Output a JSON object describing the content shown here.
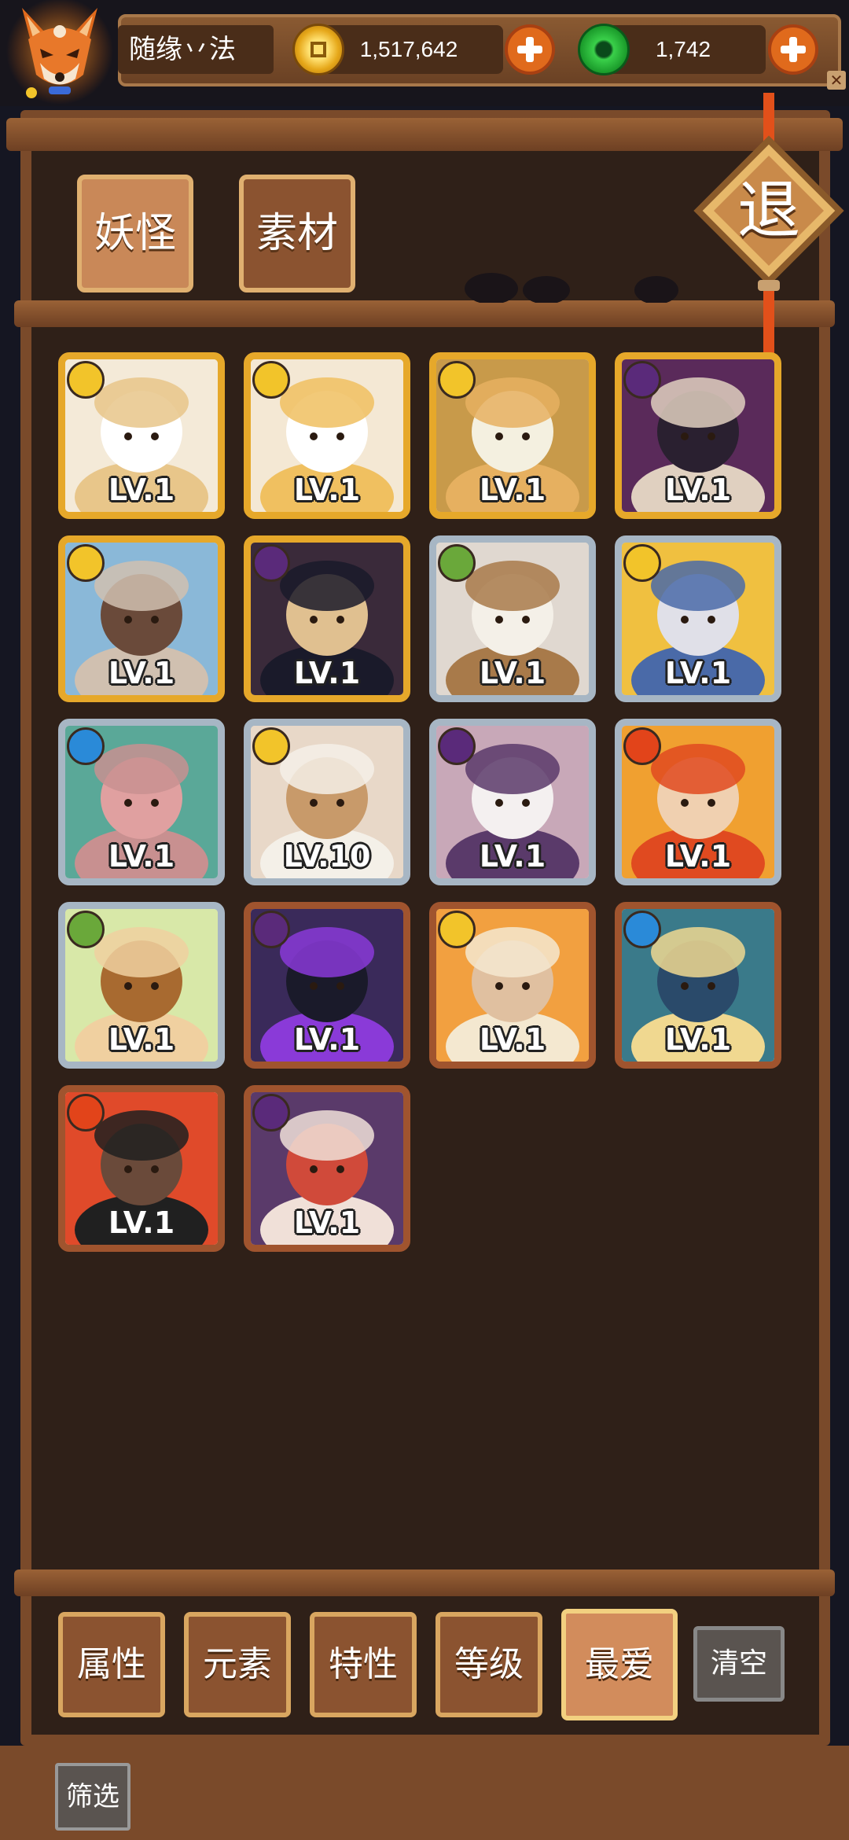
{
  "player": {
    "name": "随缘丷法"
  },
  "currency": {
    "coins": "1,517,642",
    "gems": "1,742"
  },
  "tabs": [
    {
      "label": "妖怪"
    },
    {
      "label": "素材"
    }
  ],
  "exit_label": "退",
  "cards": [
    {
      "level": "LV.1",
      "frame": "gold",
      "element": "light"
    },
    {
      "level": "LV.1",
      "frame": "gold",
      "element": "light"
    },
    {
      "level": "LV.1",
      "frame": "gold",
      "element": "light"
    },
    {
      "level": "LV.1",
      "frame": "gold",
      "element": "dark"
    },
    {
      "level": "LV.1",
      "frame": "gold",
      "element": "light"
    },
    {
      "level": "LV.1",
      "frame": "gold",
      "element": "dark"
    },
    {
      "level": "LV.1",
      "frame": "silver",
      "element": "wood"
    },
    {
      "level": "LV.1",
      "frame": "silver",
      "element": "light"
    },
    {
      "level": "LV.1",
      "frame": "silver",
      "element": "water"
    },
    {
      "level": "LV.10",
      "frame": "silver",
      "element": "light"
    },
    {
      "level": "LV.1",
      "frame": "silver",
      "element": "dark"
    },
    {
      "level": "LV.1",
      "frame": "silver",
      "element": "fire"
    },
    {
      "level": "LV.1",
      "frame": "silver",
      "element": "wood"
    },
    {
      "level": "LV.1",
      "frame": "bronze",
      "element": "dark"
    },
    {
      "level": "LV.1",
      "frame": "bronze",
      "element": "light"
    },
    {
      "level": "LV.1",
      "frame": "bronze",
      "element": "water"
    },
    {
      "level": "LV.1",
      "frame": "bronze",
      "element": "fire"
    },
    {
      "level": "LV.1",
      "frame": "bronze",
      "element": "dark"
    }
  ],
  "filters": [
    {
      "label": "属性"
    },
    {
      "label": "元素"
    },
    {
      "label": "特性"
    },
    {
      "label": "等级"
    },
    {
      "label": "最爱"
    }
  ],
  "clear_label": "清空",
  "filter_label": "筛选",
  "colors": {
    "gold_frame": "#e6a82a",
    "silver_frame": "#a7b6c4",
    "bronze_frame": "#a0542e",
    "light": "#f2c42a",
    "dark": "#5a2a7a",
    "wood": "#6aa83a",
    "water": "#2a8ad8",
    "fire": "#e2441a"
  }
}
